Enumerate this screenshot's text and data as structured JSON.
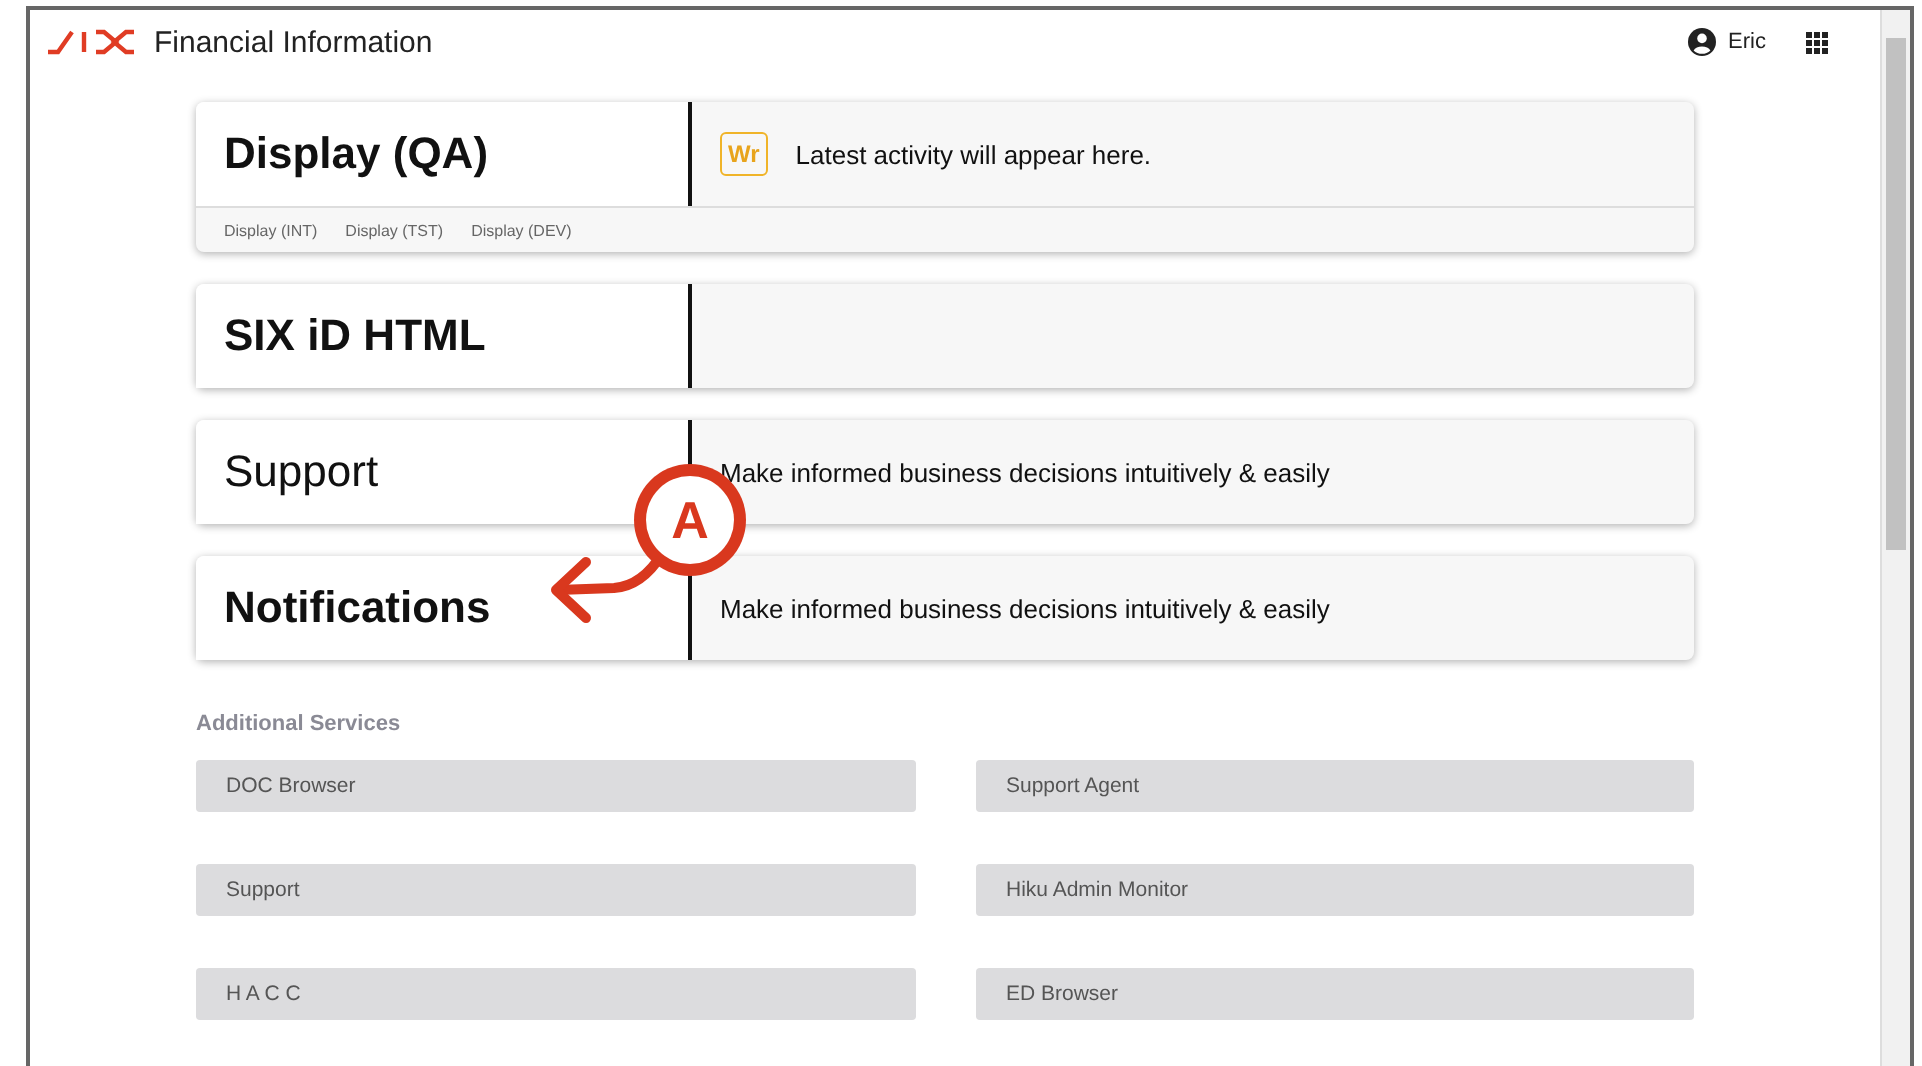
{
  "header": {
    "title": "Financial Information",
    "user": "Eric"
  },
  "cards": [
    {
      "title": "Display (QA)",
      "bold": true,
      "badge": "Wr",
      "text": "Latest activity will appear here.",
      "links": [
        "Display (INT)",
        "Display (TST)",
        "Display (DEV)"
      ]
    },
    {
      "title": "SIX iD HTML",
      "bold": true
    },
    {
      "title": "Support",
      "bold": false,
      "text": "Make informed business decisions intuitively & easily"
    },
    {
      "title": "Notifications",
      "bold": true,
      "text": "Make informed business decisions intuitively & easily"
    }
  ],
  "additional_services": {
    "heading": "Additional Services",
    "items": [
      "DOC Browser",
      "Support Agent",
      "Support",
      "Hiku Admin Monitor",
      "H A C C",
      "ED Browser"
    ]
  },
  "callout": {
    "label": "A"
  }
}
